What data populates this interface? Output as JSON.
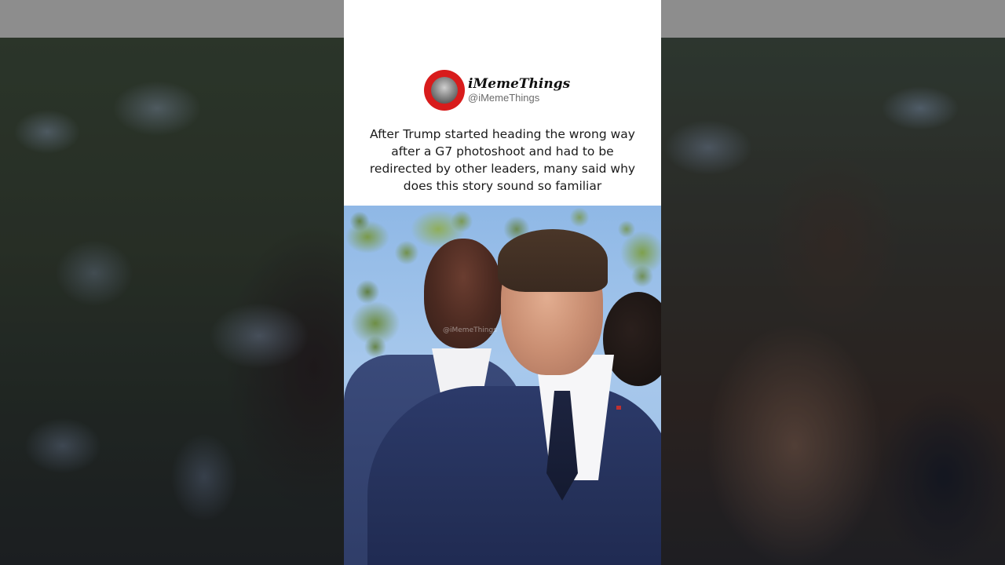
{
  "post": {
    "display_name": "iMemeThings",
    "handle": "@iMemeThings",
    "caption": "After Trump started heading the wrong way after a G7 photoshoot and had to be redirected by other leaders, many said why does this story sound so familiar"
  },
  "video": {
    "watermark": "@iMemeThings"
  },
  "colors": {
    "avatar_ring": "#d81c1c",
    "caption_bg": "#ffffff",
    "caption_text": "#1a1a1a",
    "handle_text": "#6b6b6b"
  },
  "icons": {
    "avatar": "meme-face-avatar-icon"
  }
}
